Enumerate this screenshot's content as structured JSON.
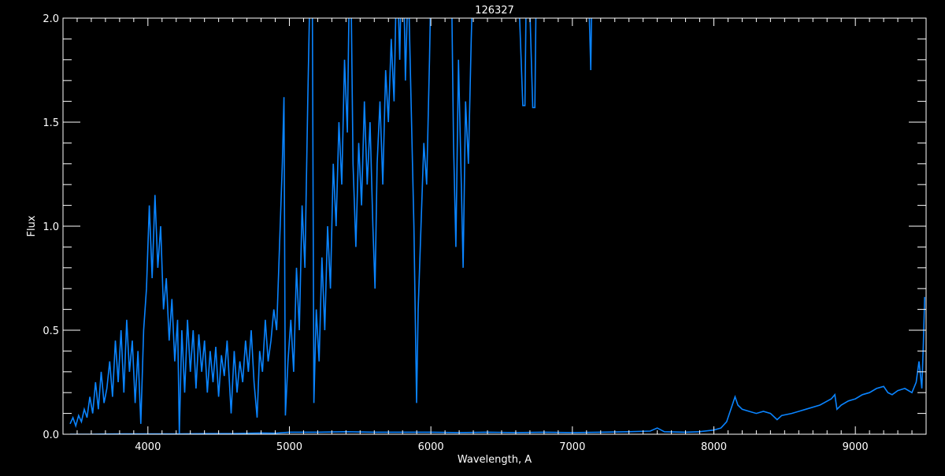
{
  "chart_data": {
    "type": "line",
    "title": "126327",
    "xlabel": "Wavelength, A",
    "ylabel": "Flux",
    "xlim": [
      3400,
      9500
    ],
    "ylim": [
      0,
      2.0
    ],
    "xticks": [
      4000,
      5000,
      6000,
      7000,
      8000,
      9000
    ],
    "xtick_labels": [
      "4000",
      "5000",
      "6000",
      "7000",
      "8000",
      "9000"
    ],
    "yticks": [
      0,
      0.5,
      1.0,
      1.5,
      2.0
    ],
    "ytick_labels": [
      "0.0",
      "0.5",
      "1.0",
      "1.5",
      "2.0"
    ],
    "grid": false,
    "background": "#000000",
    "axis_color": "#ffffff",
    "series": [
      {
        "color": "#0a84ff",
        "x": [
          3450,
          3470,
          3490,
          3510,
          3530,
          3550,
          3570,
          3590,
          3610,
          3630,
          3650,
          3670,
          3690,
          3710,
          3730,
          3750,
          3770,
          3790,
          3810,
          3830,
          3850,
          3870,
          3890,
          3910,
          3930,
          3950,
          3970,
          3990,
          4010,
          4030,
          4050,
          4070,
          4090,
          4110,
          4130,
          4150,
          4170,
          4190,
          4210,
          4222,
          4240,
          4260,
          4280,
          4300,
          4320,
          4340,
          4360,
          4380,
          4400,
          4420,
          4440,
          4460,
          4480,
          4500,
          4520,
          4540,
          4560,
          4588,
          4610,
          4630,
          4650,
          4670,
          4690,
          4710,
          4730,
          4750,
          4772,
          4790,
          4810,
          4830,
          4850,
          4870,
          4890,
          4910,
          4930,
          4950,
          4962,
          4972,
          4990,
          5010,
          5030,
          5050,
          5070,
          5090,
          5110,
          5130,
          5150,
          5160,
          5173,
          5190,
          5210,
          5230,
          5250,
          5270,
          5290,
          5310,
          5330,
          5350,
          5370,
          5390,
          5410,
          5430,
          5450,
          5470,
          5490,
          5510,
          5530,
          5550,
          5570,
          5590,
          5605,
          5620,
          5640,
          5660,
          5680,
          5700,
          5720,
          5740,
          5760,
          5780,
          5800,
          5820,
          5840,
          5860,
          5880,
          5899,
          5910,
          5930,
          5950,
          5970,
          5990,
          6010,
          6030,
          6060,
          6100,
          6140,
          6160,
          6177,
          6195,
          6215,
          6228,
          6245,
          6265,
          6285,
          6310,
          6400,
          6500,
          6600,
          6650,
          6665,
          6680,
          6720,
          6735,
          6750,
          6900,
          7100,
          7130,
          7145,
          7300
        ],
        "y": [
          0.05,
          0.08,
          0.04,
          0.09,
          0.06,
          0.12,
          0.08,
          0.18,
          0.1,
          0.25,
          0.12,
          0.3,
          0.15,
          0.22,
          0.35,
          0.18,
          0.45,
          0.25,
          0.5,
          0.2,
          0.55,
          0.3,
          0.45,
          0.15,
          0.4,
          0.05,
          0.5,
          0.7,
          1.1,
          0.75,
          1.15,
          0.8,
          1.0,
          0.6,
          0.75,
          0.45,
          0.65,
          0.35,
          0.55,
          0.0,
          0.5,
          0.2,
          0.55,
          0.3,
          0.5,
          0.22,
          0.48,
          0.3,
          0.45,
          0.2,
          0.4,
          0.25,
          0.42,
          0.18,
          0.38,
          0.28,
          0.45,
          0.1,
          0.4,
          0.2,
          0.35,
          0.25,
          0.45,
          0.3,
          0.5,
          0.25,
          0.08,
          0.4,
          0.3,
          0.55,
          0.35,
          0.45,
          0.6,
          0.5,
          0.9,
          1.3,
          1.62,
          0.09,
          0.35,
          0.55,
          0.3,
          0.8,
          0.5,
          1.1,
          0.8,
          1.6,
          2.3,
          2.5,
          0.15,
          0.6,
          0.35,
          0.85,
          0.5,
          1.0,
          0.7,
          1.3,
          1.0,
          1.5,
          1.2,
          1.8,
          1.45,
          2.5,
          1.3,
          0.9,
          1.4,
          1.1,
          1.6,
          1.2,
          1.5,
          1.0,
          0.7,
          1.3,
          1.6,
          1.2,
          1.75,
          1.5,
          1.9,
          1.6,
          2.3,
          1.8,
          2.5,
          1.7,
          2.2,
          1.6,
          1.0,
          0.15,
          0.6,
          1.0,
          1.4,
          1.2,
          1.8,
          2.5,
          2.5,
          2.5,
          2.5,
          2.5,
          1.4,
          0.9,
          1.8,
          1.2,
          0.8,
          1.6,
          1.3,
          1.9,
          2.5,
          2.5,
          2.5,
          2.5,
          1.58,
          1.58,
          2.5,
          1.57,
          1.57,
          2.5,
          2.5,
          2.5,
          1.75,
          2.5,
          2.5
        ]
      },
      {
        "color": "#0a84ff",
        "x": [
          3450,
          3600,
          3800,
          4000,
          4200,
          4400,
          4600,
          4800,
          4900,
          5000,
          5200,
          5400,
          5600,
          5800,
          6000,
          6200,
          6400,
          6600,
          6800,
          7000,
          7200,
          7400,
          7550,
          7600,
          7650,
          7800,
          7900,
          8000,
          8050,
          8090,
          8120,
          8150,
          8170,
          8200,
          8250,
          8300,
          8350,
          8400,
          8447,
          8480,
          8550,
          8650,
          8750,
          8830,
          8855,
          8870,
          8900,
          8950,
          9000,
          9050,
          9100,
          9150,
          9200,
          9230,
          9260,
          9300,
          9350,
          9400,
          9430,
          9450,
          9470,
          9480,
          9490
        ],
        "y": [
          0.0,
          0.0,
          0.002,
          0.002,
          0.002,
          0.003,
          0.003,
          0.006,
          0.005,
          0.01,
          0.01,
          0.012,
          0.01,
          0.01,
          0.01,
          0.008,
          0.01,
          0.008,
          0.01,
          0.008,
          0.01,
          0.012,
          0.015,
          0.03,
          0.012,
          0.01,
          0.012,
          0.02,
          0.03,
          0.06,
          0.12,
          0.18,
          0.14,
          0.12,
          0.11,
          0.1,
          0.11,
          0.1,
          0.07,
          0.09,
          0.1,
          0.12,
          0.14,
          0.17,
          0.19,
          0.12,
          0.14,
          0.16,
          0.17,
          0.19,
          0.2,
          0.22,
          0.23,
          0.2,
          0.19,
          0.21,
          0.22,
          0.2,
          0.25,
          0.35,
          0.22,
          0.42,
          0.66
        ]
      }
    ]
  }
}
